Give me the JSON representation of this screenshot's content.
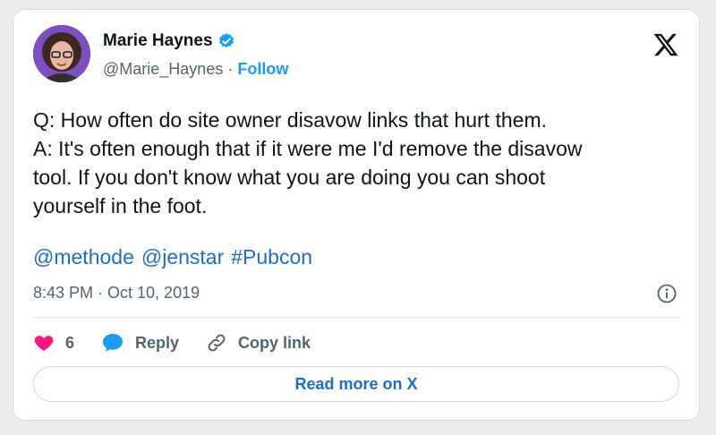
{
  "author": {
    "name": "Marie Haynes",
    "handle": "@Marie_Haynes",
    "separator": "·",
    "follow_label": "Follow"
  },
  "tweet": {
    "lines": [
      "Q: How often do site owner disavow links that hurt them.",
      "A: It's often enough that if it were me I'd remove the disavow",
      "tool. If you don't know what you are doing you can shoot",
      "yourself in the foot."
    ],
    "mentions": [
      "@methode",
      "@jenstar",
      "#Pubcon"
    ],
    "timestamp": "8:43 PM · Oct 10, 2019"
  },
  "actions": {
    "like_count": "6",
    "reply_label": "Reply",
    "copy_link_label": "Copy link"
  },
  "read_more_label": "Read more on X",
  "colors": {
    "accent": "#1d9bf0",
    "link": "#1d6fc4",
    "like": "#f91880",
    "muted": "#536471"
  },
  "icons": {
    "verified": "verified-badge-icon",
    "x": "x-logo-icon",
    "info": "info-icon",
    "like": "heart-icon",
    "reply": "speech-bubble-icon",
    "copy": "link-icon"
  }
}
